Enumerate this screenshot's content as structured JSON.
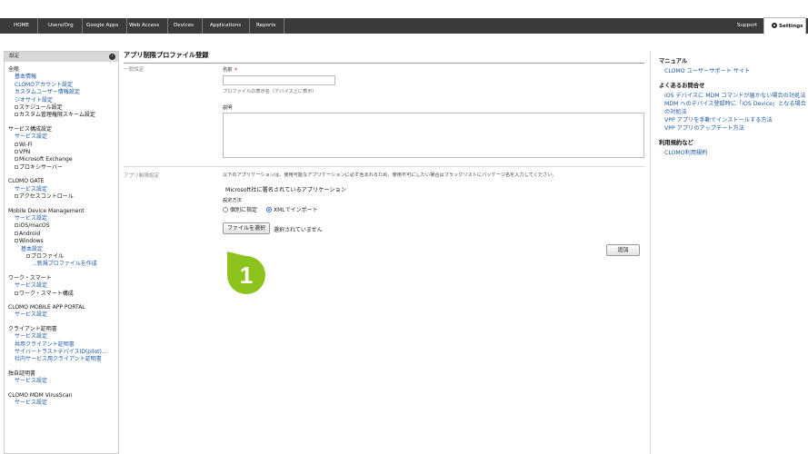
{
  "nav": {
    "items": [
      "HOME",
      "Users/Org",
      "Google Apps",
      "Web Access",
      "Devices",
      "Applications",
      "Reports"
    ],
    "support": "Support",
    "settings": "Settings"
  },
  "sidebar": {
    "header": "設定",
    "sections": [
      {
        "title": "全般",
        "items": [
          {
            "t": "link",
            "label": "基本情報"
          },
          {
            "t": "link",
            "label": "CLOMOアカウント設定"
          },
          {
            "t": "link",
            "label": "カスタムユーザー情報設定"
          },
          {
            "t": "link",
            "label": "ジオサイト設定"
          },
          {
            "t": "tree",
            "label": "スケジュール設定"
          },
          {
            "t": "tree",
            "label": "カスタム管理権限スキーム設定"
          }
        ]
      },
      {
        "title": "サービス構成設定",
        "items": [
          {
            "t": "link",
            "label": "サービス設定"
          },
          {
            "t": "tree",
            "label": "Wi-Fi"
          },
          {
            "t": "tree",
            "label": "VPN"
          },
          {
            "t": "tree",
            "label": "Microsoft Exchange"
          },
          {
            "t": "tree",
            "label": "プロキシサーバー"
          }
        ]
      },
      {
        "title": "CLOMO GATE",
        "items": [
          {
            "t": "link",
            "label": "サービス設定"
          },
          {
            "t": "tree",
            "label": "アクセスコントロール"
          }
        ]
      },
      {
        "title": "Mobile Device Management",
        "items": [
          {
            "t": "link",
            "label": "サービス設定"
          },
          {
            "t": "tree",
            "label": "iOS/macOS"
          },
          {
            "t": "tree",
            "label": "Android"
          },
          {
            "t": "tree",
            "label": "Windows"
          },
          {
            "t": "link2",
            "label": "基本設定"
          },
          {
            "t": "tree2",
            "label": "プロファイル"
          },
          {
            "t": "link3",
            "label": "...新規プロファイルを作成"
          }
        ]
      },
      {
        "title": "ワーク・スマート",
        "items": [
          {
            "t": "link",
            "label": "サービス設定"
          },
          {
            "t": "tree",
            "label": "ワーク・スマート構成"
          }
        ]
      },
      {
        "title": "CLOMO MOBILE APP PORTAL",
        "items": [
          {
            "t": "link",
            "label": "サービス設定"
          }
        ]
      },
      {
        "title": "クライアント証明書",
        "items": [
          {
            "t": "link",
            "label": "サービス設定"
          },
          {
            "t": "link",
            "label": "共用クライアント証明書"
          },
          {
            "t": "link",
            "label": "サイバートラストデバイスID(pilot)..."
          },
          {
            "t": "link",
            "label": "社内サービス用クライアント証明書"
          }
        ]
      },
      {
        "title": "独自証明書",
        "items": [
          {
            "t": "link",
            "label": "サービス設定"
          }
        ]
      },
      {
        "title": "CLOMO MDM VirusScan",
        "items": [
          {
            "t": "link",
            "label": "サービス設定"
          }
        ]
      }
    ]
  },
  "main": {
    "title": "アプリ制限プロファイル登録",
    "general_section": "一般設定",
    "name_label": "名前",
    "required_mark": "＊",
    "name_value": "",
    "name_hint": "プロファイルの表示名（デバイス上に表示）",
    "desc_label": "説明",
    "desc_value": "",
    "app_section": "アプリ制限設定",
    "app_note": "以下のアプリケーションは、使用可能なアプリケーションに必ず含まれるため、使用不可にしたい場合はブラックリストにパッケージ名を入力してください。",
    "ms_apps": "Microsoft社に署名されているアプリケーション",
    "method_label": "設定方法",
    "radio_individual": "個別に指定",
    "radio_xml": "XMLでインポート",
    "file_button": "ファイルを選択",
    "file_status": "選択されていません",
    "add_button": "追加",
    "callout_number": "1"
  },
  "rightbar": {
    "groups": [
      {
        "title": "マニュアル",
        "links": [
          "CLOMO ユーザーサポート サイト"
        ]
      },
      {
        "title": "よくあるお問合せ",
        "links": [
          "iOS デバイスに MDM コマンドが届かない場合の対処法",
          "MDM へのデバイス登録時に「iOS Device」となる場合の対処法",
          "VPP アプリを手動でインストールする方法",
          "VPP アプリのアップデート方法"
        ]
      },
      {
        "title": "利用規約など",
        "links": [
          "CLOMO利用規約"
        ]
      }
    ]
  },
  "colors": {
    "nav_bg": "#3b3b3b",
    "link": "#1a57a6",
    "callout": "#8dc21f"
  }
}
